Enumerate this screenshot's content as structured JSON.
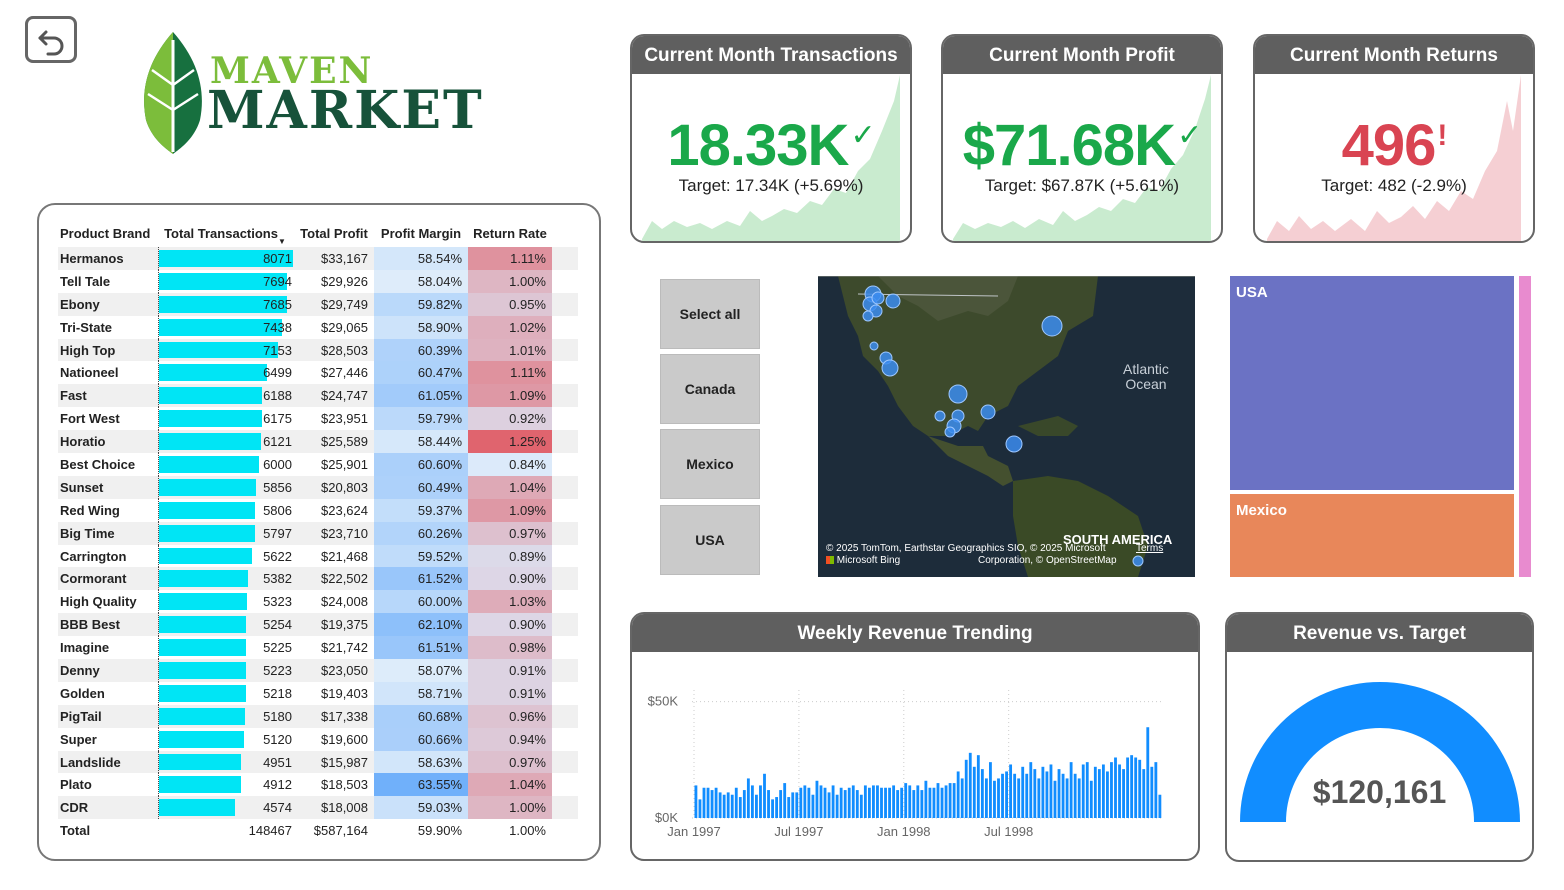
{
  "logo": {
    "word1": "MAVEN",
    "word2": "MARKET"
  },
  "table": {
    "headers": {
      "brand": "Product Brand",
      "transactions": "Total Transactions",
      "profit": "Total Profit",
      "margin": "Profit Margin",
      "return_rate": "Return Rate"
    },
    "rows": [
      {
        "brand": "Hermanos",
        "transactions": 8071,
        "profit": "$33,167",
        "margin": "58.54%",
        "return_rate": "1.11%"
      },
      {
        "brand": "Tell Tale",
        "transactions": 7694,
        "profit": "$29,926",
        "margin": "58.04%",
        "return_rate": "1.00%"
      },
      {
        "brand": "Ebony",
        "transactions": 7685,
        "profit": "$29,749",
        "margin": "59.82%",
        "return_rate": "0.95%"
      },
      {
        "brand": "Tri-State",
        "transactions": 7438,
        "profit": "$29,065",
        "margin": "58.90%",
        "return_rate": "1.02%"
      },
      {
        "brand": "High Top",
        "transactions": 7153,
        "profit": "$28,503",
        "margin": "60.39%",
        "return_rate": "1.01%"
      },
      {
        "brand": "Nationeel",
        "transactions": 6499,
        "profit": "$27,446",
        "margin": "60.47%",
        "return_rate": "1.11%"
      },
      {
        "brand": "Fast",
        "transactions": 6188,
        "profit": "$24,747",
        "margin": "61.05%",
        "return_rate": "1.09%"
      },
      {
        "brand": "Fort West",
        "transactions": 6175,
        "profit": "$23,951",
        "margin": "59.79%",
        "return_rate": "0.92%"
      },
      {
        "brand": "Horatio",
        "transactions": 6121,
        "profit": "$25,589",
        "margin": "58.44%",
        "return_rate": "1.25%"
      },
      {
        "brand": "Best Choice",
        "transactions": 6000,
        "profit": "$25,901",
        "margin": "60.60%",
        "return_rate": "0.84%"
      },
      {
        "brand": "Sunset",
        "transactions": 5856,
        "profit": "$20,803",
        "margin": "60.49%",
        "return_rate": "1.04%"
      },
      {
        "brand": "Red Wing",
        "transactions": 5806,
        "profit": "$23,624",
        "margin": "59.37%",
        "return_rate": "1.09%"
      },
      {
        "brand": "Big Time",
        "transactions": 5797,
        "profit": "$23,710",
        "margin": "60.26%",
        "return_rate": "0.97%"
      },
      {
        "brand": "Carrington",
        "transactions": 5622,
        "profit": "$21,468",
        "margin": "59.52%",
        "return_rate": "0.89%"
      },
      {
        "brand": "Cormorant",
        "transactions": 5382,
        "profit": "$22,502",
        "margin": "61.52%",
        "return_rate": "0.90%"
      },
      {
        "brand": "High Quality",
        "transactions": 5323,
        "profit": "$24,008",
        "margin": "60.00%",
        "return_rate": "1.03%"
      },
      {
        "brand": "BBB Best",
        "transactions": 5254,
        "profit": "$19,375",
        "margin": "62.10%",
        "return_rate": "0.90%"
      },
      {
        "brand": "Imagine",
        "transactions": 5225,
        "profit": "$21,742",
        "margin": "61.51%",
        "return_rate": "0.98%"
      },
      {
        "brand": "Denny",
        "transactions": 5223,
        "profit": "$23,050",
        "margin": "58.07%",
        "return_rate": "0.91%"
      },
      {
        "brand": "Golden",
        "transactions": 5218,
        "profit": "$19,403",
        "margin": "58.71%",
        "return_rate": "0.91%"
      },
      {
        "brand": "PigTail",
        "transactions": 5180,
        "profit": "$17,338",
        "margin": "60.68%",
        "return_rate": "0.96%"
      },
      {
        "brand": "Super",
        "transactions": 5120,
        "profit": "$19,600",
        "margin": "60.66%",
        "return_rate": "0.94%"
      },
      {
        "brand": "Landslide",
        "transactions": 4951,
        "profit": "$15,987",
        "margin": "58.63%",
        "return_rate": "0.97%"
      },
      {
        "brand": "Plato",
        "transactions": 4912,
        "profit": "$18,503",
        "margin": "63.55%",
        "return_rate": "1.04%"
      },
      {
        "brand": "CDR",
        "transactions": 4574,
        "profit": "$18,008",
        "margin": "59.03%",
        "return_rate": "1.00%"
      }
    ],
    "total": {
      "brand": "Total",
      "transactions": "148467",
      "profit": "$587,164",
      "margin": "59.90%",
      "return_rate": "1.00%"
    }
  },
  "kpis": {
    "transactions": {
      "title": "Current Month Transactions",
      "value": "18.33K",
      "mark": "✓",
      "target": "Target: 17.34K (+5.69%)",
      "color": "#1aa84a",
      "fill": "#c9ebcf"
    },
    "profit": {
      "title": "Current Month Profit",
      "value": "$71.68K",
      "mark": "✓",
      "target": "Target: $67.87K (+5.61%)",
      "color": "#1aa84a",
      "fill": "#c9ebcf"
    },
    "returns": {
      "title": "Current Month Returns",
      "value": "496",
      "mark": "!",
      "target": "Target: 482 (-2.9%)",
      "color": "#d94452",
      "fill": "#f5cfd3"
    }
  },
  "slicer": {
    "options": [
      "Select all",
      "Canada",
      "Mexico",
      "USA"
    ]
  },
  "map": {
    "ocean_label_1": "Atlantic",
    "ocean_label_2": "Ocean",
    "continent_label": "SOUTH AMERICA",
    "attribution_1": "© 2025 TomTom, Earthstar Geographics SIO, © 2025 Microsoft",
    "attribution_2": "Corporation, © OpenStreetMap",
    "bing": "Microsoft Bing",
    "terms": "Terms"
  },
  "treemap": {
    "items": [
      {
        "label": "USA",
        "color": "#6b72c4"
      },
      {
        "label": "Mexico",
        "color": "#e8875a"
      },
      {
        "label": "",
        "color": "#e88bcf"
      }
    ]
  },
  "weekly_revenue": {
    "title": "Weekly Revenue Trending",
    "chart_data": {
      "type": "bar",
      "y_ticks": [
        "$50K",
        "$0K"
      ],
      "x_ticks": [
        "Jan 1997",
        "Jul 1997",
        "Jan 1998",
        "Jul 1998"
      ],
      "ylim": [
        0,
        55000
      ],
      "values": [
        14000,
        8000,
        13000,
        13000,
        12000,
        13000,
        11000,
        10000,
        11000,
        10000,
        13000,
        9000,
        12000,
        17000,
        14000,
        10000,
        14000,
        19000,
        12000,
        8000,
        9000,
        12000,
        15000,
        9000,
        11000,
        11000,
        13000,
        14000,
        13000,
        10000,
        16000,
        14000,
        13000,
        11000,
        14000,
        10000,
        13000,
        12000,
        13000,
        14000,
        12000,
        10000,
        14000,
        13000,
        14000,
        14000,
        13000,
        13000,
        13000,
        14000,
        12000,
        13000,
        15000,
        14000,
        12000,
        14000,
        12000,
        16000,
        13000,
        13000,
        15000,
        13000,
        14000,
        15000,
        15000,
        20000,
        17000,
        25000,
        28000,
        22000,
        27000,
        21000,
        17000,
        24000,
        16000,
        17000,
        19000,
        20000,
        23000,
        19000,
        17000,
        22000,
        19000,
        24000,
        21000,
        17000,
        22000,
        20000,
        23000,
        16000,
        21000,
        19000,
        17000,
        24000,
        19000,
        17000,
        23000,
        24000,
        16000,
        22000,
        21000,
        23000,
        20000,
        24000,
        26000,
        23000,
        21000,
        26000,
        27000,
        26000,
        25000,
        21000,
        39000,
        22000,
        24000,
        10000
      ]
    }
  },
  "gauge": {
    "title": "Revenue vs. Target",
    "value": "$120,161",
    "color": "#118dff"
  }
}
